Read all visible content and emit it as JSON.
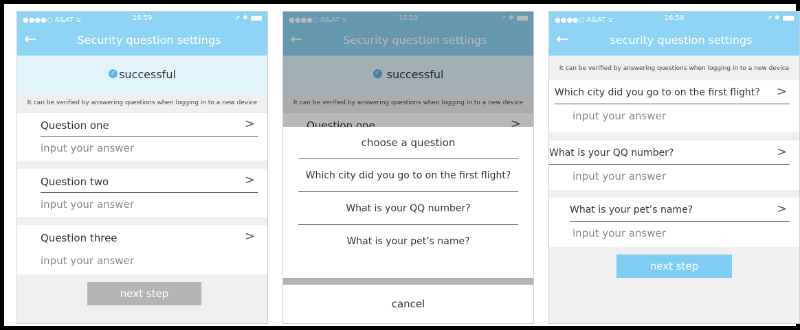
{
  "status": {
    "carrier": "●●●●○ A&AT ᯤ",
    "time": "16:59",
    "right": "↗ ✱"
  },
  "screen1": {
    "title": "Security question settings",
    "success": "successful",
    "hint": "It can be verified by answering questions when logging in to a new device",
    "questions": [
      {
        "label": "Question one",
        "placeholder": "input your answer"
      },
      {
        "label": "Question two",
        "placeholder": "input your answer"
      },
      {
        "label": "Question three",
        "placeholder": "input your answer"
      }
    ],
    "next": "next step",
    "next_color": "#b5b5b5"
  },
  "screen2": {
    "title": "Security question settings",
    "success": "successful",
    "hint": "It can be verified by answering questions when logging in to a new device",
    "question_one": "Question one",
    "sheet": {
      "title": "choose a question",
      "options": [
        "Which city did you go to on the first flight?",
        "What is your QQ number?",
        "What is your pet’s name?"
      ],
      "cancel": "cancel"
    }
  },
  "screen3": {
    "title": "security question settings",
    "hint": "It can be verified by answering questions when logging in to a new device",
    "questions": [
      {
        "label": "Which city did you go to on the first flight?",
        "placeholder": "input your answer"
      },
      {
        "label": "What is your QQ number?",
        "placeholder": "input your answer"
      },
      {
        "label": "What is your pet’s name?",
        "placeholder": "input your answer"
      }
    ],
    "next": "next step",
    "next_color": "#7fcff5"
  },
  "icons": {
    "back": "back-arrow-icon",
    "chevron": "chevron-right-icon",
    "check": "check-circle-icon"
  }
}
